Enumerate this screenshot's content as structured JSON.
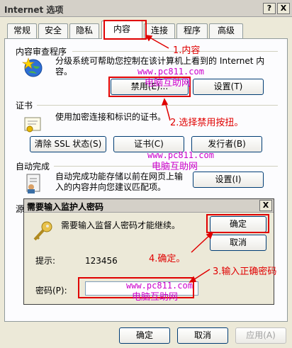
{
  "window": {
    "title": "Internet 选项",
    "help_button": "?",
    "close_button": "X"
  },
  "tabs": [
    {
      "label": "常规"
    },
    {
      "label": "安全"
    },
    {
      "label": "隐私"
    },
    {
      "label": "内容"
    },
    {
      "label": "连接"
    },
    {
      "label": "程序"
    },
    {
      "label": "高级"
    }
  ],
  "content_advisor": {
    "group_label": "内容审查程序",
    "description": "分级系统可帮助您控制在该计算机上看到的 Internet 内容。",
    "disable_button": "禁用(E)...",
    "settings_button": "设置(T)"
  },
  "certificates": {
    "group_label": "证书",
    "description": "使用加密连接和标识的证书。",
    "clear_ssl_button": "清除 SSL 状态(S)",
    "certificates_button": "证书(C)",
    "publishers_button": "发行者(B)"
  },
  "autocomplete": {
    "group_label": "自动完成",
    "description": "自动完成功能存储以前在网页上输入的内容并向您建议匹配项。",
    "settings_button": "设置(I)"
  },
  "feeds": {
    "group_label_partial": "源"
  },
  "password_dialog": {
    "title": "需要输入监护人密码",
    "close_button": "X",
    "message": "需要输入监督人密码才能继续。",
    "ok_button": "确定",
    "cancel_button": "取消",
    "hint_label": "提示:",
    "hint_value": "123456",
    "password_label": "密码(P):",
    "password_value": ""
  },
  "bottom_buttons": {
    "ok": "确定",
    "cancel": "取消",
    "apply": "应用(A)"
  },
  "annotations": {
    "step1": "1.内容",
    "step2": "2.选择禁用按扭。",
    "step3": "3.输入正确密码",
    "step4": "4.确定。",
    "watermark_url": "www.pc811.com",
    "watermark_name": "电脑互助网"
  },
  "colors": {
    "annotation_red": "#e00000",
    "watermark_magenta": "#cc00cc",
    "window_bg": "#ece9d8"
  }
}
